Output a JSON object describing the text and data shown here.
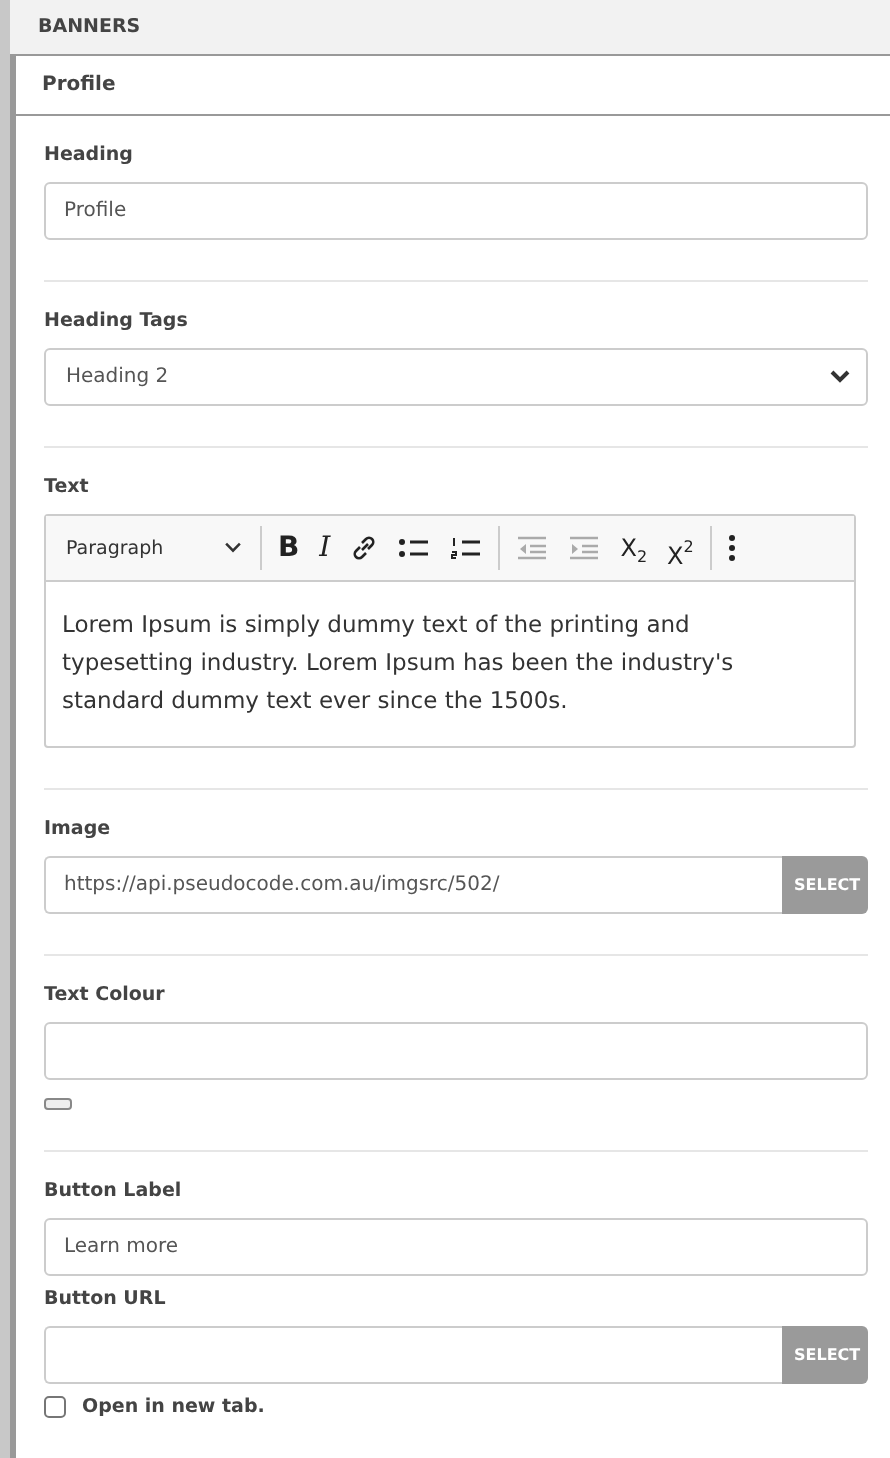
{
  "panel": {
    "title": "BANNERS"
  },
  "item": {
    "title": "Profile"
  },
  "sections": [
    {
      "fields": [
        {
          "kind": "text",
          "label": "Heading",
          "value": "Profile"
        }
      ]
    },
    {
      "fields": [
        {
          "kind": "select",
          "label": "Heading Tags",
          "value": "Heading 2"
        }
      ]
    },
    {
      "fields": [
        {
          "kind": "richtext",
          "label": "Text",
          "format": "Paragraph",
          "tool_groups": [
            [
              {
                "kind": "bold",
                "label": "B",
                "disabled": false
              },
              {
                "kind": "italic",
                "label": "I",
                "disabled": false
              },
              {
                "kind": "link",
                "disabled": false
              },
              {
                "kind": "bullets",
                "disabled": false
              },
              {
                "kind": "numbers",
                "disabled": false
              }
            ],
            [
              {
                "kind": "outdent",
                "disabled": true
              },
              {
                "kind": "indent",
                "disabled": true
              },
              {
                "kind": "script",
                "label": "X$_{2}$",
                "disabled": false
              },
              {
                "kind": "script",
                "label": "X$^{2}$",
                "disabled": false
              }
            ],
            [
              {
                "kind": "more",
                "disabled": false
              }
            ]
          ],
          "value": "Lorem Ipsum is simply dummy text of the printing and typesetting industry. Lorem Ipsum has been the industry's standard dummy text ever since the 1500s."
        }
      ]
    },
    {
      "fields": [
        {
          "kind": "picker",
          "label": "Image",
          "value": "https://api.pseudocode.com.au/imgsrc/502/",
          "button": "SELECT"
        }
      ]
    },
    {
      "fields": [
        {
          "kind": "colour",
          "label": "Text Colour"
        }
      ]
    },
    {
      "fields": [
        {
          "kind": "text",
          "label": "Button Label",
          "value": "Learn more"
        },
        {
          "kind": "picker",
          "label": "Button URL",
          "button": "SELECT"
        },
        {
          "kind": "checkbox",
          "label": "Open in new tab.",
          "checked": false
        }
      ]
    }
  ]
}
